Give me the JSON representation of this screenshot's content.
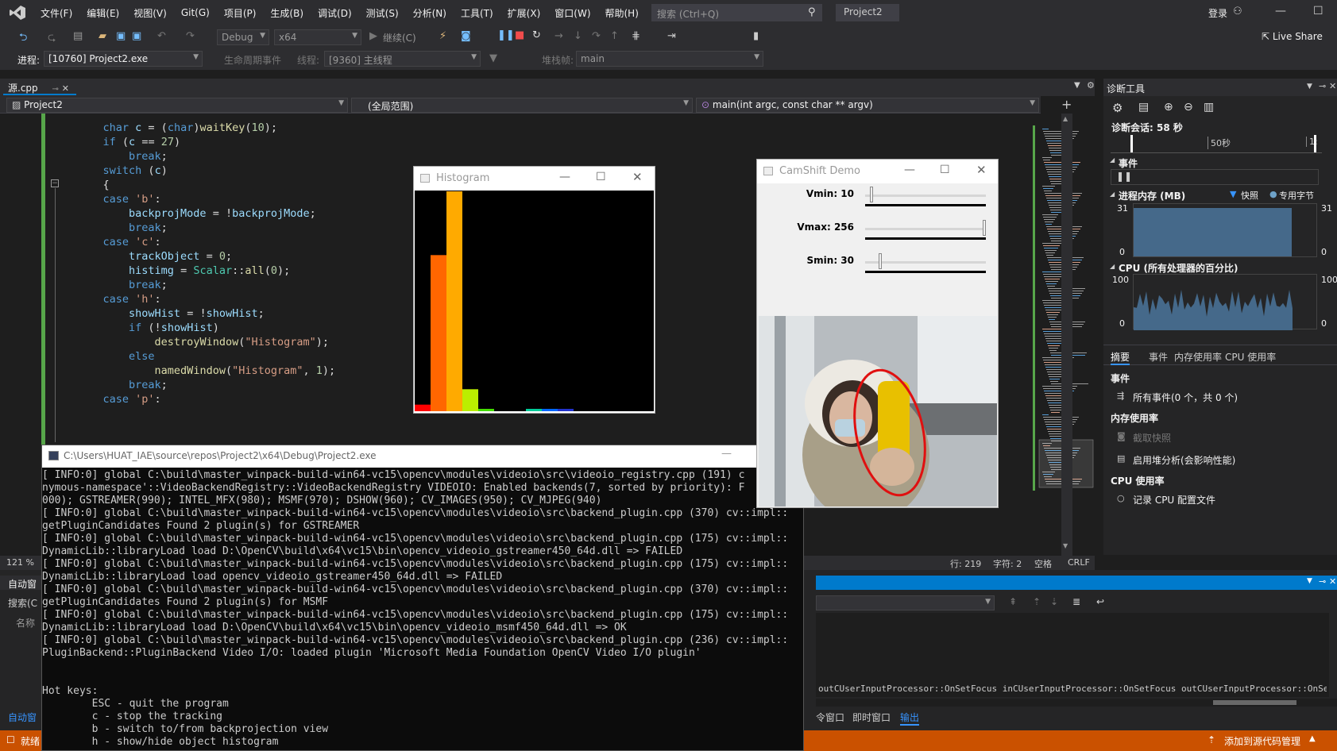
{
  "menu": [
    "文件(F)",
    "编辑(E)",
    "视图(V)",
    "Git(G)",
    "项目(P)",
    "生成(B)",
    "调试(D)",
    "测试(S)",
    "分析(N)",
    "工具(T)",
    "扩展(X)",
    "窗口(W)",
    "帮助(H)"
  ],
  "search_placeholder": "搜索 (Ctrl+Q)",
  "project_name": "Project2",
  "login": "登录",
  "live_share": "Live Share",
  "toolbar": {
    "config": "Debug",
    "platform": "x64",
    "continue": "继续(C)",
    "process_label": "进程:",
    "process_value": "[10760] Project2.exe",
    "lifecycle": "生命周期事件",
    "thread_label": "线程:",
    "thread_value": "[9360] 主线程",
    "stack_label": "堆栈帧:",
    "stack_value": "main"
  },
  "editor": {
    "tab": "源.cpp",
    "nav_project": "Project2",
    "nav_scope": "(全局范围)",
    "nav_func": "main(int argc, const char ** argv)",
    "zoom": "121 %",
    "status_line": "行: 219",
    "status_char": "字符: 2",
    "status_space": "空格",
    "status_eol": "CRLF",
    "code": [
      {
        "indent": "    ",
        "parts": [
          [
            "kw",
            "char "
          ],
          [
            "var",
            "c"
          ],
          [
            "",
            " = ("
          ],
          [
            "kw",
            "char"
          ],
          [
            "",
            ")"
          ],
          [
            "fn",
            "waitKey"
          ],
          [
            "",
            "("
          ],
          [
            "num",
            "10"
          ],
          [
            "",
            ");"
          ]
        ]
      },
      {
        "indent": "    ",
        "parts": [
          [
            "kw",
            "if "
          ],
          [
            "",
            "("
          ],
          [
            "var",
            "c"
          ],
          [
            "",
            " == "
          ],
          [
            "num",
            "27"
          ],
          [
            "",
            ")"
          ]
        ]
      },
      {
        "indent": "        ",
        "parts": [
          [
            "kw",
            "break"
          ],
          [
            "",
            ";"
          ]
        ]
      },
      {
        "indent": "    ",
        "parts": [
          [
            "kw",
            "switch "
          ],
          [
            "",
            "("
          ],
          [
            "var",
            "c"
          ],
          [
            "",
            ")"
          ]
        ]
      },
      {
        "indent": "    ",
        "parts": [
          [
            "",
            "{"
          ]
        ]
      },
      {
        "indent": "    ",
        "parts": [
          [
            "kw",
            "case "
          ],
          [
            "str",
            "'b'"
          ],
          [
            "",
            ":"
          ]
        ]
      },
      {
        "indent": "        ",
        "parts": [
          [
            "var",
            "backprojMode"
          ],
          [
            "",
            " = !"
          ],
          [
            "var",
            "backprojMode"
          ],
          [
            "",
            ";"
          ]
        ]
      },
      {
        "indent": "        ",
        "parts": [
          [
            "kw",
            "break"
          ],
          [
            "",
            ";"
          ]
        ]
      },
      {
        "indent": "    ",
        "parts": [
          [
            "kw",
            "case "
          ],
          [
            "str",
            "'c'"
          ],
          [
            "",
            ":"
          ]
        ]
      },
      {
        "indent": "        ",
        "parts": [
          [
            "var",
            "trackObject"
          ],
          [
            "",
            " = "
          ],
          [
            "num",
            "0"
          ],
          [
            "",
            ";"
          ]
        ]
      },
      {
        "indent": "        ",
        "parts": [
          [
            "var",
            "histimg"
          ],
          [
            "",
            " = "
          ],
          [
            "ty",
            "Scalar"
          ],
          [
            "",
            "::"
          ],
          [
            "fn",
            "all"
          ],
          [
            "",
            "("
          ],
          [
            "num",
            "0"
          ],
          [
            "",
            ");"
          ]
        ]
      },
      {
        "indent": "        ",
        "parts": [
          [
            "kw",
            "break"
          ],
          [
            "",
            ";"
          ]
        ]
      },
      {
        "indent": "    ",
        "parts": [
          [
            "kw",
            "case "
          ],
          [
            "str",
            "'h'"
          ],
          [
            "",
            ":"
          ]
        ]
      },
      {
        "indent": "        ",
        "parts": [
          [
            "var",
            "showHist"
          ],
          [
            "",
            " = !"
          ],
          [
            "var",
            "showHist"
          ],
          [
            "",
            ";"
          ]
        ]
      },
      {
        "indent": "        ",
        "parts": [
          [
            "kw",
            "if "
          ],
          [
            "",
            "(!"
          ],
          [
            "var",
            "showHist"
          ],
          [
            "",
            ")"
          ]
        ]
      },
      {
        "indent": "            ",
        "parts": [
          [
            "fn",
            "destroyWindow"
          ],
          [
            "",
            "("
          ],
          [
            "str",
            "\"Histogram\""
          ],
          [
            "",
            ");"
          ]
        ]
      },
      {
        "indent": "        ",
        "parts": [
          [
            "kw",
            "else"
          ]
        ]
      },
      {
        "indent": "            ",
        "parts": [
          [
            "fn",
            "namedWindow"
          ],
          [
            "",
            "("
          ],
          [
            "str",
            "\"Histogram\""
          ],
          [
            "",
            ", "
          ],
          [
            "num",
            "1"
          ],
          [
            "",
            ");"
          ]
        ]
      },
      {
        "indent": "        ",
        "parts": [
          [
            "kw",
            "break"
          ],
          [
            "",
            ";"
          ]
        ]
      },
      {
        "indent": "    ",
        "parts": [
          [
            "kw",
            "case "
          ],
          [
            "str",
            "'p'"
          ],
          [
            "",
            ":"
          ]
        ]
      }
    ]
  },
  "diagnostics": {
    "title": "诊断工具",
    "session": "诊断会话: 58 秒",
    "timeline_tick": "50秒",
    "timeline_end": "1:",
    "events": "事件",
    "memory": "进程内存 (MB)",
    "snapshot": "快照",
    "private_bytes": "专用字节",
    "mem_max": "31",
    "mem_min": "0",
    "cpu": "CPU (所有处理器的百分比)",
    "cpu_max": "100",
    "cpu_min": "0",
    "tabs": [
      "摘要",
      "事件",
      "内存使用率",
      "CPU 使用率"
    ],
    "sec_events": "事件",
    "all_events": "所有事件(0 个，共 0 个)",
    "sec_memory": "内存使用率",
    "take_snapshot": "截取快照",
    "heap_profile": "启用堆分析(会影响性能)",
    "sec_cpu": "CPU 使用率",
    "record_cpu": "记录 CPU 配置文件"
  },
  "histogram": {
    "title": "Histogram",
    "bars": [
      {
        "color": "#ff0000",
        "value": 0.03
      },
      {
        "color": "#ff6600",
        "value": 0.71
      },
      {
        "color": "#ffaa00",
        "value": 1.0
      },
      {
        "color": "#bbee00",
        "value": 0.1
      },
      {
        "color": "#44dd00",
        "value": 0.01
      },
      {
        "color": "#000000",
        "value": 0.0
      },
      {
        "color": "#000000",
        "value": 0.0
      },
      {
        "color": "#00cc99",
        "value": 0.006
      },
      {
        "color": "#0066ff",
        "value": 0.01
      },
      {
        "color": "#2233cc",
        "value": 0.01
      }
    ]
  },
  "camshift": {
    "title": "CamShift Demo",
    "sliders": [
      {
        "label": "Vmin: 10",
        "value": 10,
        "max": 256
      },
      {
        "label": "Vmax: 256",
        "value": 256,
        "max": 256
      },
      {
        "label": "Smin: 30",
        "value": 30,
        "max": 256
      }
    ]
  },
  "console": {
    "title": "C:\\Users\\HUAT_IAE\\source\\repos\\Project2\\x64\\Debug\\Project2.exe",
    "lines": [
      "[ INFO:0] global C:\\build\\master_winpack-build-win64-vc15\\opencv\\modules\\videoio\\src\\videoio_registry.cpp (191) c",
      "nymous-namespace'::VideoBackendRegistry::VideoBackendRegistry VIDEOIO: Enabled backends(7, sorted by priority): F",
      "000); GSTREAMER(990); INTEL_MFX(980); MSMF(970); DSHOW(960); CV_IMAGES(950); CV_MJPEG(940)",
      "[ INFO:0] global C:\\build\\master_winpack-build-win64-vc15\\opencv\\modules\\videoio\\src\\backend_plugin.cpp (370) cv::impl::",
      "getPluginCandidates Found 2 plugin(s) for GSTREAMER",
      "[ INFO:0] global C:\\build\\master_winpack-build-win64-vc15\\opencv\\modules\\videoio\\src\\backend_plugin.cpp (175) cv::impl::",
      "DynamicLib::libraryLoad load D:\\OpenCV\\build\\x64\\vc15\\bin\\opencv_videoio_gstreamer450_64d.dll => FAILED",
      "[ INFO:0] global C:\\build\\master_winpack-build-win64-vc15\\opencv\\modules\\videoio\\src\\backend_plugin.cpp (175) cv::impl::",
      "DynamicLib::libraryLoad load opencv_videoio_gstreamer450_64d.dll => FAILED",
      "[ INFO:0] global C:\\build\\master_winpack-build-win64-vc15\\opencv\\modules\\videoio\\src\\backend_plugin.cpp (370) cv::impl::",
      "getPluginCandidates Found 2 plugin(s) for MSMF",
      "[ INFO:0] global C:\\build\\master_winpack-build-win64-vc15\\opencv\\modules\\videoio\\src\\backend_plugin.cpp (175) cv::impl::",
      "DynamicLib::libraryLoad load D:\\OpenCV\\build\\x64\\vc15\\bin\\opencv_videoio_msmf450_64d.dll => OK",
      "[ INFO:0] global C:\\build\\master_winpack-build-win64-vc15\\opencv\\modules\\videoio\\src\\backend_plugin.cpp (236) cv::impl::",
      "PluginBackend::PluginBackend Video I/O: loaded plugin 'Microsoft Media Foundation OpenCV Video I/O plugin'",
      "",
      "",
      "Hot keys:",
      "        ESC - quit the program",
      "        c - stop the tracking",
      "        b - switch to/from backprojection view",
      "        h - show/hide object histogram"
    ]
  },
  "bottom": {
    "auto_window": "自动窗",
    "search": "搜索(C",
    "name_col": "名称",
    "auto_tab": "自动窗",
    "output_text": "outCUserInputProcessor::OnSetFocus inCUserInputProcessor::OnSetFocus outCUserInputProcessor::OnSetFocus out",
    "tabs": [
      "令窗口",
      "即时窗口",
      "输出"
    ],
    "status_ready": "就绪",
    "add_source": "添加到源代码管理"
  }
}
